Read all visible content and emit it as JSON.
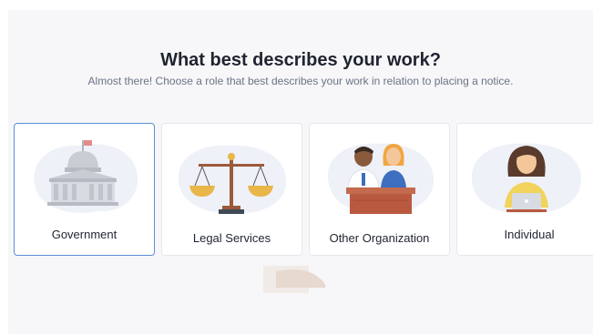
{
  "heading": "What best describes your work?",
  "subheading": "Almost there! Choose a role that best describes your work in relation to placing a notice.",
  "roles": [
    {
      "label": "Government",
      "icon": "capitol-building-icon",
      "selected": true
    },
    {
      "label": "Legal Services",
      "icon": "scales-of-justice-icon",
      "selected": false
    },
    {
      "label": "Other Organization",
      "icon": "people-at-desk-icon",
      "selected": false
    },
    {
      "label": "Individual",
      "icon": "person-with-laptop-icon",
      "selected": false
    }
  ],
  "colors": {
    "selected_border": "#5b8fd6",
    "panel_bg": "#f7f7f9",
    "blob": "#eef1f7",
    "gold": "#e8b649",
    "wood": "#b9593f"
  }
}
